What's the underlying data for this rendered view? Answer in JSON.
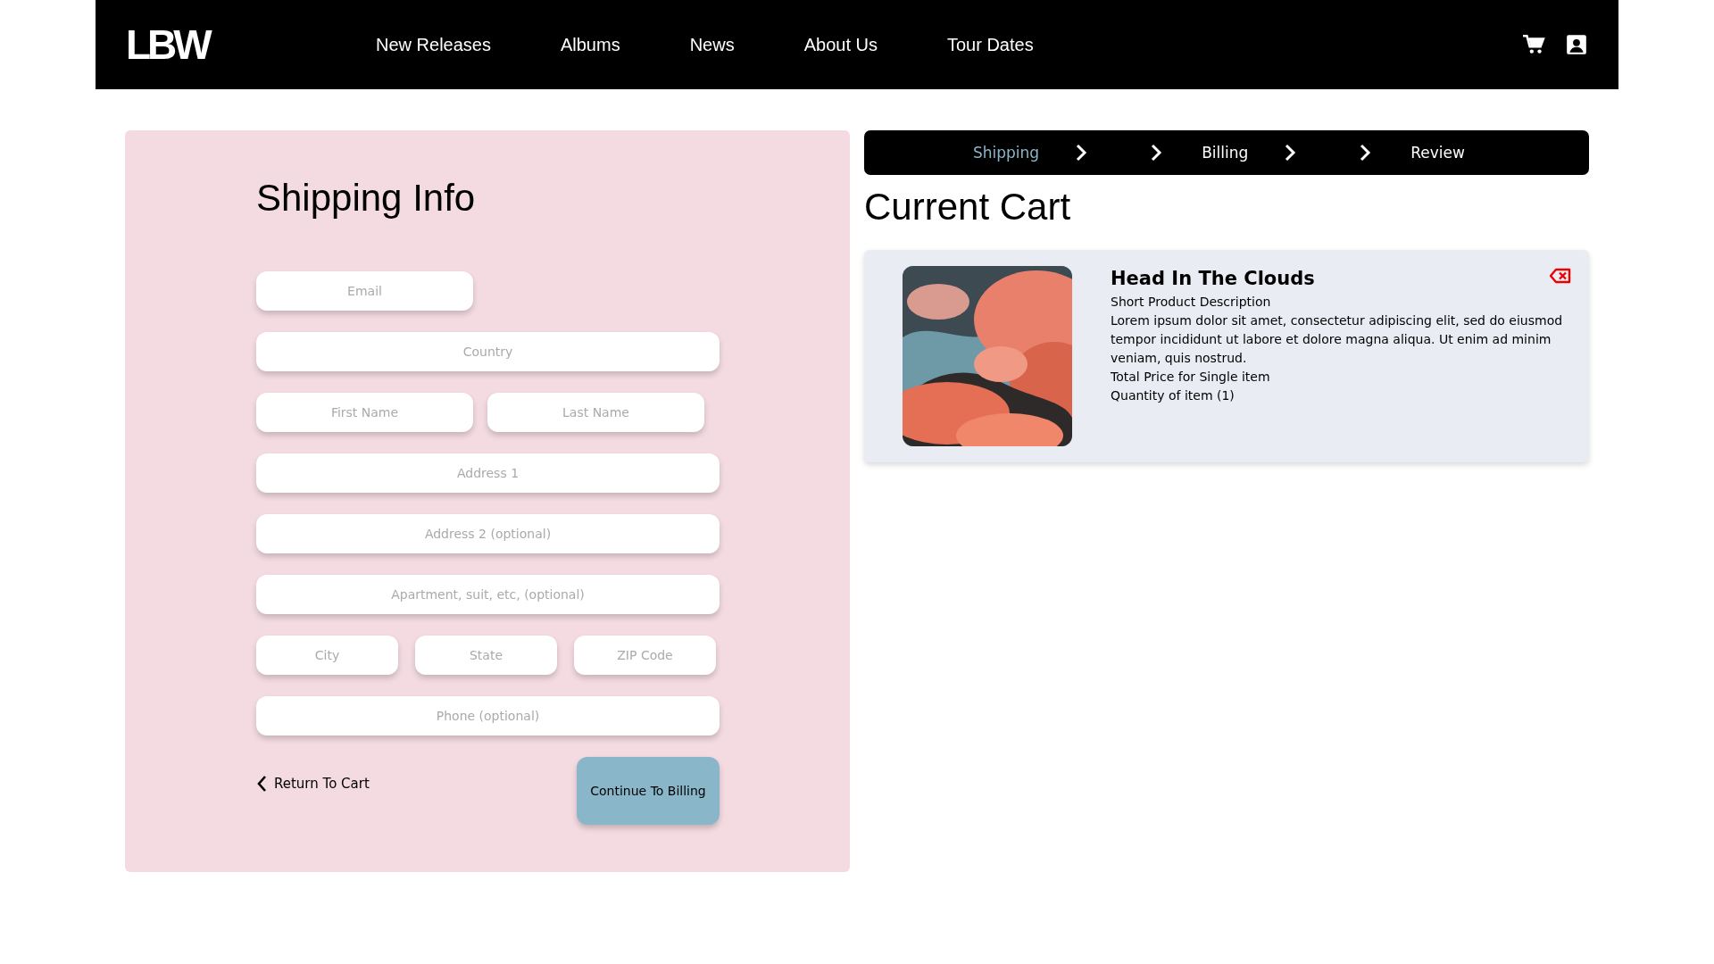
{
  "header": {
    "logo": "LBW",
    "nav": [
      "New Releases",
      "Albums",
      "News",
      "About Us",
      "Tour Dates"
    ]
  },
  "shipping_form": {
    "title": "Shipping Info",
    "fields": [
      {
        "placeholder": "Email",
        "kind": "half"
      },
      {
        "placeholder": "Country",
        "kind": "full"
      },
      {
        "placeholder": "First Name",
        "kind": "half"
      },
      {
        "placeholder": "Last Name",
        "kind": "half"
      },
      {
        "placeholder": "Address 1",
        "kind": "full"
      },
      {
        "placeholder": "Address 2 (optional)",
        "kind": "full"
      },
      {
        "placeholder": "Apartment, suit, etc, (optional)",
        "kind": "full"
      },
      {
        "placeholder": "City",
        "kind": "third"
      },
      {
        "placeholder": "State",
        "kind": "third"
      },
      {
        "placeholder": "ZIP Code",
        "kind": "third"
      },
      {
        "placeholder": "Phone (optional)",
        "kind": "full"
      }
    ],
    "back_link": "Return To Cart",
    "continue_button": "Continue To Billing"
  },
  "steps": [
    {
      "label": "Shipping",
      "selected": true
    },
    {
      "label": "Billing",
      "selected": false
    },
    {
      "label": "Review",
      "selected": false
    }
  ],
  "cart": {
    "title": "Current Cart",
    "items": [
      {
        "image": {
          "kind": "picture"
        },
        "name": "Head In The Clouds",
        "lines": [
          "Short Product Description",
          "Lorem ipsum dolor sit amet, consectetur adipiscing elit, sed do eiusmod tempor incididunt ut labore et dolore magna aliqua. Ut enim ad minim veniam, quis nostrud.",
          "Total Price for Single item",
          "Quantity of item (1)"
        ]
      }
    ]
  }
}
